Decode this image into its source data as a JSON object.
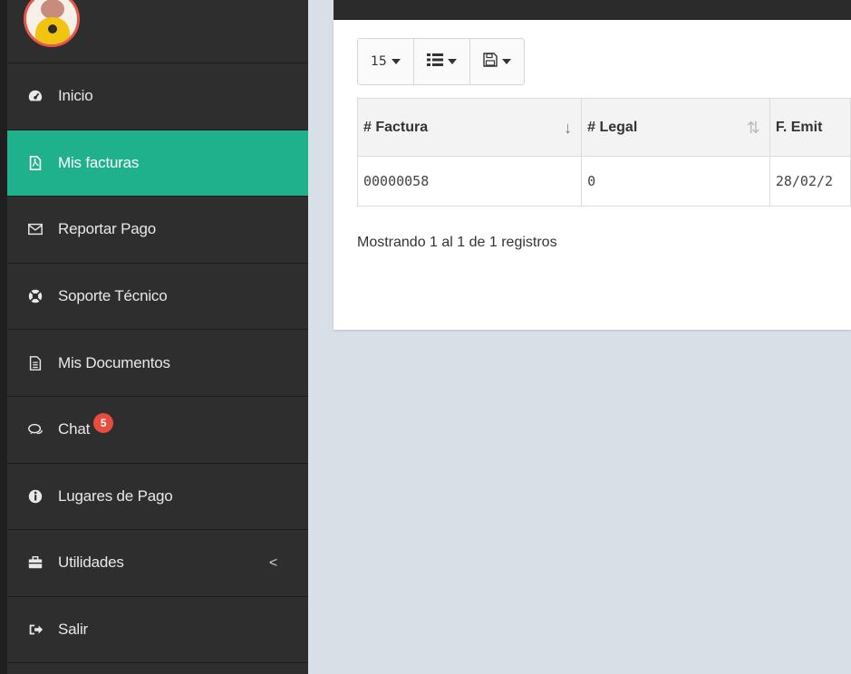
{
  "sidebar": {
    "items": [
      {
        "label": "Inicio",
        "icon": "dashboard-icon"
      },
      {
        "label": "Mis facturas",
        "icon": "pdf-file-icon",
        "active": true
      },
      {
        "label": "Reportar Pago",
        "icon": "envelope-icon"
      },
      {
        "label": "Soporte Técnico",
        "icon": "life-ring-icon"
      },
      {
        "label": "Mis Documentos",
        "icon": "document-icon"
      },
      {
        "label": "Chat",
        "icon": "chat-bubbles-icon",
        "badge": "5"
      },
      {
        "label": "Lugares de Pago",
        "icon": "info-circle-icon"
      },
      {
        "label": "Utilidades",
        "icon": "briefcase-icon",
        "chevron": "<"
      },
      {
        "label": "Salir",
        "icon": "sign-out-icon"
      }
    ]
  },
  "toolbar": {
    "page_size": "15",
    "columns_icon": "list-icon",
    "export_icon": "save-icon"
  },
  "table": {
    "headers": [
      "# Factura",
      "# Legal",
      "F. Emit"
    ],
    "rows": [
      [
        "00000058",
        "0",
        "28/02/2"
      ]
    ]
  },
  "footer": {
    "info": "Mostrando 1 al 1 de 1 registros"
  },
  "colors": {
    "sidebar_bg": "#2e2e2e",
    "active_bg": "#1fb08c",
    "badge_bg": "#e74c3c",
    "content_bg": "#d9dfe7"
  }
}
